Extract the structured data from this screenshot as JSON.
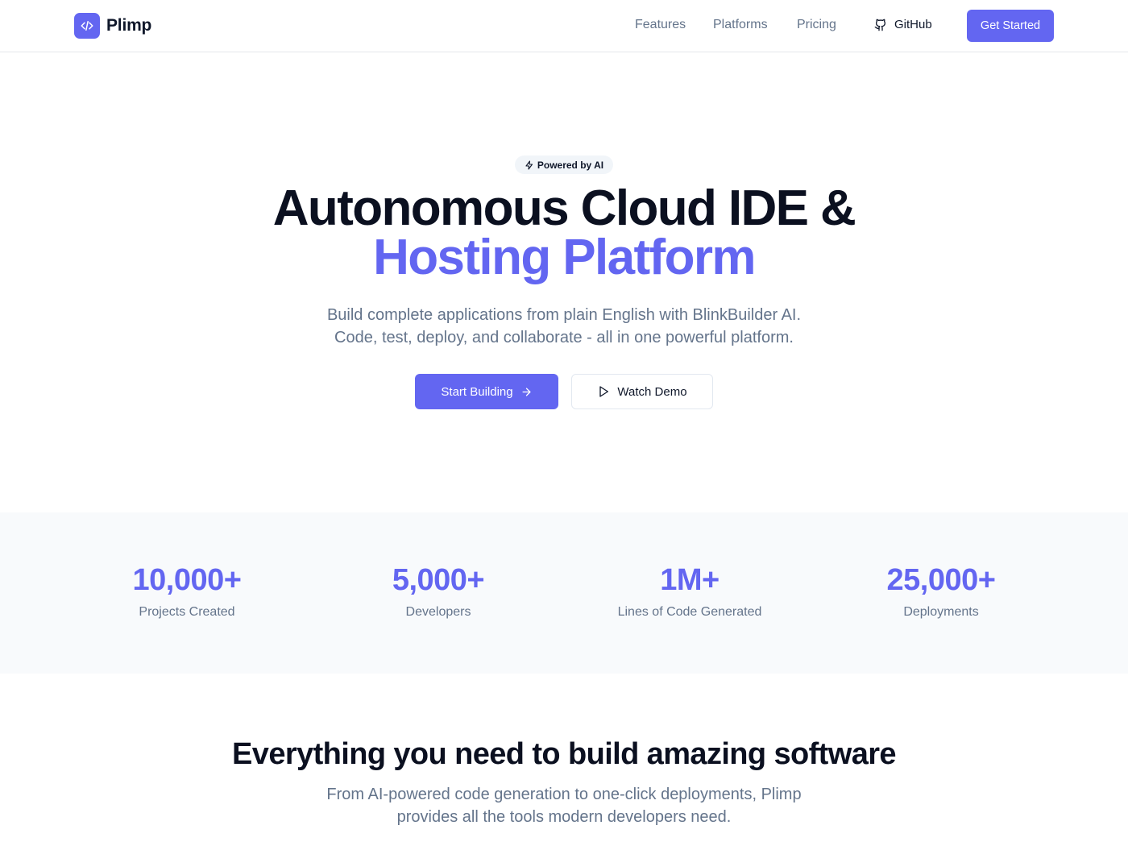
{
  "colors": {
    "accent": "#6366f1",
    "heading": "#0b1020",
    "muted_text": "#64748b",
    "stats_background": "#f8fafc"
  },
  "nav": {
    "brand_name": "Plimp",
    "brand_icon": "code-icon",
    "links": [
      "Features",
      "Platforms",
      "Pricing"
    ],
    "github_label": "GitHub",
    "github_icon": "github-icon",
    "cta_label": "Get Started"
  },
  "hero": {
    "badge_label": "Powered by AI",
    "badge_icon": "lightning-icon",
    "title_line1": "Autonomous Cloud IDE &",
    "title_line2": "Hosting Platform",
    "subtitle_line1": "Build complete applications from plain English with BlinkBuilder AI.",
    "subtitle_line2": "Code, test, deploy, and collaborate - all in one powerful platform.",
    "primary_button_label": "Start Building",
    "primary_button_icon": "arrow-right-icon",
    "secondary_button_label": "Watch Demo",
    "secondary_button_icon": "play-icon"
  },
  "stats": [
    {
      "value": "10,000+",
      "label": "Projects Created"
    },
    {
      "value": "5,000+",
      "label": "Developers"
    },
    {
      "value": "1M+",
      "label": "Lines of Code Generated"
    },
    {
      "value": "25,000+",
      "label": "Deployments"
    }
  ],
  "features_intro": {
    "title": "Everything you need to build amazing software",
    "subtitle_line1": "From AI-powered code generation to one-click deployments, Plimp",
    "subtitle_line2": "provides all the tools modern developers need."
  }
}
